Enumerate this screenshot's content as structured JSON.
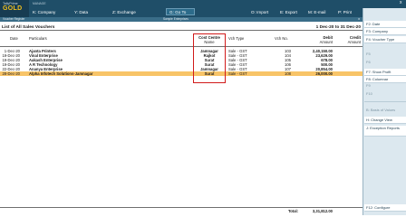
{
  "app": {
    "logo_line1": "TallyPrime",
    "logo_line2": "GOLD",
    "sub_nav": "MANAGE",
    "menu": [
      {
        "key": "K",
        "label": "Company",
        "full": "K: Company"
      },
      {
        "key": "Y",
        "label": "Data",
        "full": "Y: Data"
      },
      {
        "key": "Z",
        "label": "Exchange",
        "full": "Z: Exchange"
      }
    ],
    "goto_label": "G: Go To",
    "right_menu": [
      {
        "full": "O: Import"
      },
      {
        "full": "E: Export"
      },
      {
        "full": "M: E-mail"
      },
      {
        "full": "P: Print"
      },
      {
        "full": "F1: Help"
      }
    ],
    "close_symbol": "x"
  },
  "subbar": {
    "left": "Voucher Register",
    "mid": "Sample Enterprises",
    "close": "x"
  },
  "report": {
    "title": "List of All Sales Vouchers",
    "period": "1 Dec-20 to 31 Dec-20"
  },
  "columns": {
    "date": "Date",
    "particulars": "Particulars",
    "cost_centre_line1": "Cost Centre",
    "cost_centre_line2": "Name",
    "vch_type": "Vch Type",
    "vch_no": "Vch No.",
    "debit_line1": "Debit",
    "debit_line2": "Amount",
    "credit_line1": "Credit",
    "credit_line2": "Amount"
  },
  "rows": [
    {
      "date": "1-Dec-20",
      "particulars": "Ajanta Printers",
      "cost_centre": "Jamnagar",
      "vch_type": "Sale - GST",
      "vch_no": "103",
      "debit": "2,40,150.00",
      "credit": ""
    },
    {
      "date": "19-Dec-20",
      "particulars": "Vinal Enterprise",
      "cost_centre": "Rajkot",
      "vch_type": "Sale - GST",
      "vch_no": "104",
      "debit": "23,629.00",
      "credit": ""
    },
    {
      "date": "19-Dec-20",
      "particulars": "Aakash Enterprise",
      "cost_centre": "Surat",
      "vch_type": "Sale - GST",
      "vch_no": "105",
      "debit": "678.00",
      "credit": ""
    },
    {
      "date": "19-Dec-20",
      "particulars": "A R Technology",
      "cost_centre": "Surat",
      "vch_type": "Sale - GST",
      "vch_no": "106",
      "debit": "500.00",
      "credit": ""
    },
    {
      "date": "22-Dec-20",
      "particulars": "Ananya Enterprise",
      "cost_centre": "Jamnagar",
      "vch_type": "Sale - GST",
      "vch_no": "107",
      "debit": "20,854.00",
      "credit": ""
    },
    {
      "date": "28-Dec-20",
      "particulars": "Alpha Infotech Solutions-Jamnagar",
      "cost_centre": "Surat",
      "vch_type": "Sale - GST",
      "vch_no": "108",
      "debit": "26,000.00",
      "credit": "",
      "selected": true
    }
  ],
  "footer": {
    "total_label": "Total:",
    "total_value": "3,31,812.00"
  },
  "right_panel": {
    "items": [
      {
        "label": "F2: Date"
      },
      {
        "label": "F3: Company"
      },
      {
        "label": "F4: Voucher Type"
      },
      {
        "label": "F5"
      },
      {
        "label": "F6"
      },
      {
        "label": "F7: Show Profit"
      },
      {
        "label": "F8: Columnar"
      },
      {
        "label": "F9"
      },
      {
        "label": "F10"
      },
      {
        "label": "B: Basis of Values"
      },
      {
        "label": "H: Change View"
      },
      {
        "label": "J: Exception Reports"
      },
      {
        "label": "F12: Configure"
      }
    ],
    "chevron": "›"
  },
  "colors": {
    "topbar": "#1f4e68",
    "logo_gold": "#f2c01e",
    "selection": "#f8c468",
    "highlight_box": "#d11a1a",
    "panel": "#dce8ef"
  }
}
